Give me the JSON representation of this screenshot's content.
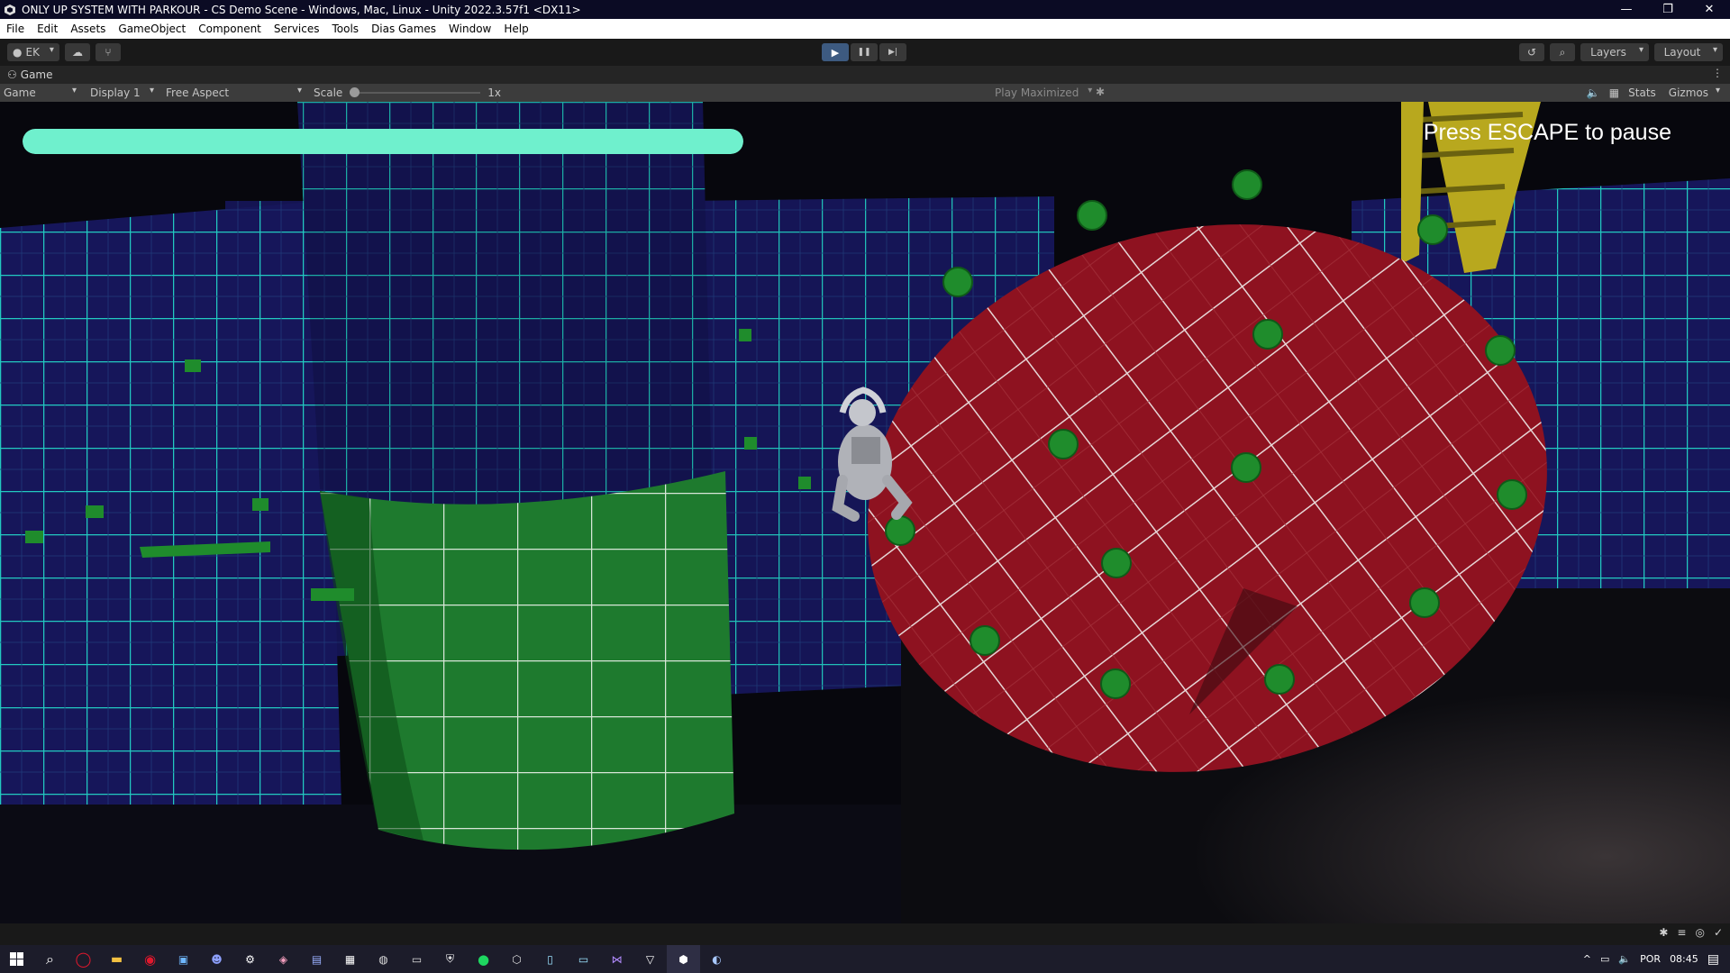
{
  "window": {
    "title": "ONLY UP SYSTEM WITH PARKOUR - CS Demo Scene - Windows, Mac, Linux - Unity 2022.3.57f1 <DX11>",
    "minimize": "—",
    "restore": "❐",
    "close": "✕"
  },
  "menu": {
    "items": [
      "File",
      "Edit",
      "Assets",
      "GameObject",
      "Component",
      "Services",
      "Tools",
      "Dias Games",
      "Window",
      "Help"
    ]
  },
  "toolbar": {
    "account_label": "EK",
    "play_icon": "▶",
    "pause_icon": "❚❚",
    "step_icon": "▶|",
    "layers_label": "Layers",
    "layout_label": "Layout"
  },
  "tab": {
    "label": "Game"
  },
  "gamebar": {
    "mode": "Game",
    "display": "Display 1",
    "aspect": "Free Aspect",
    "scale_label": "Scale",
    "scale_value": "1x",
    "scale_slider_fraction": 0.0,
    "play_mode": "Play Maximized",
    "stats_label": "Stats",
    "gizmos_label": "Gizmos"
  },
  "hud": {
    "health_fraction": 1.0,
    "pause_hint": "Press ESCAPE to pause",
    "health_color": "#6ff0cd"
  },
  "colors": {
    "grid_line": "#22c9c0",
    "wall_blue": "#16165a",
    "pillar_green": "#1e7a2e",
    "disc_red": "#8e1220",
    "ladder_yellow": "#b8a81e",
    "peg_green": "#1f8c2c"
  },
  "taskbar": {
    "language": "POR",
    "time": "08:45"
  }
}
